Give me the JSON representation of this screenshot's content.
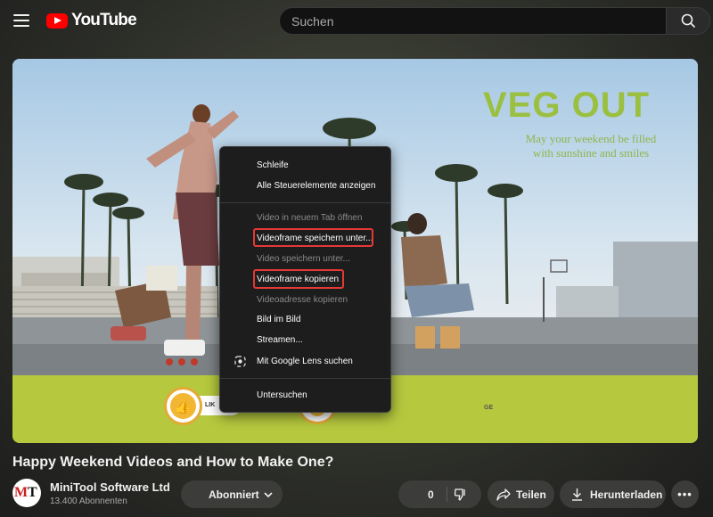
{
  "header": {
    "logo_text": "YouTube",
    "search_placeholder": "Suchen"
  },
  "video": {
    "overlay_title": "VEG OUT",
    "overlay_subtitle_line1": "May your weekend be filled",
    "overlay_subtitle_line2": "with sunshine and smiles",
    "like_pill_text": "LIK",
    "ge_text": "GE"
  },
  "context_menu": {
    "items": [
      {
        "label": "Schleife",
        "enabled": true
      },
      {
        "label": "Alle Steuerelemente anzeigen",
        "enabled": true
      },
      {
        "label": "Video in neuem Tab öffnen",
        "enabled": false
      },
      {
        "label": "Videoframe speichern unter...",
        "enabled": true,
        "highlighted": true
      },
      {
        "label": "Video speichern unter...",
        "enabled": false
      },
      {
        "label": "Videoframe kopieren",
        "enabled": true,
        "highlighted": true
      },
      {
        "label": "Videoadresse kopieren",
        "enabled": false
      },
      {
        "label": "Bild im Bild",
        "enabled": true
      },
      {
        "label": "Streamen...",
        "enabled": true
      },
      {
        "label": "Mit Google Lens suchen",
        "enabled": true,
        "icon": "google-lens-icon"
      },
      {
        "label": "Untersuchen",
        "enabled": true
      }
    ],
    "highlight_color": "#e53935"
  },
  "info": {
    "title": "Happy Weekend Videos and How to Make One?",
    "channel_name": "MiniTool Software Ltd",
    "avatar_letter_m": "M",
    "avatar_letter_t": "T",
    "subscriber_count": "13.400 Abonnenten",
    "subscribe_label": "Abonniert",
    "like_count": "0",
    "share_label": "Teilen",
    "download_label": "Herunterladen",
    "more_label": "•••"
  },
  "colors": {
    "youtube_red": "#ff0000",
    "overlay_green": "#9bc041",
    "pill_bg": "#3c3c3a"
  }
}
